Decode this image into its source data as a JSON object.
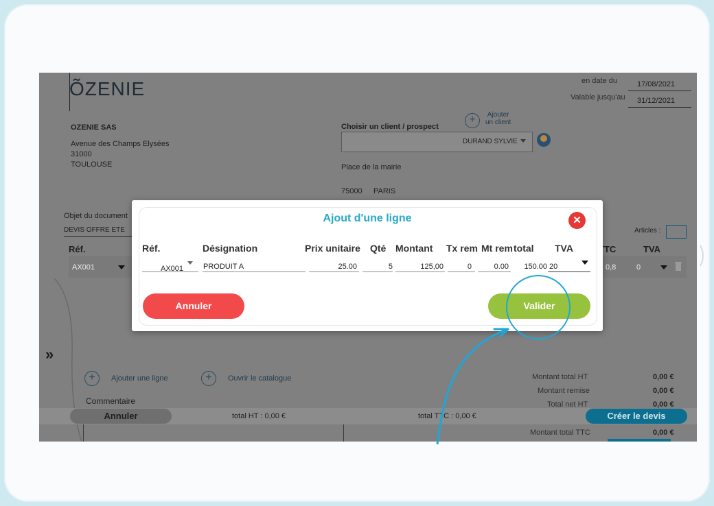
{
  "company": {
    "logo": "ÕZENIE",
    "name": "OZENIE SAS",
    "address": "Avenue des Champs Elysées",
    "postcode": "31000",
    "city": "TOULOUSE"
  },
  "dates": {
    "date_label": "en date du",
    "date_value": "17/08/2021",
    "valid_label": "Valable jusqu'au",
    "valid_value": "31/12/2021"
  },
  "client": {
    "choose_label": "Choisir un client / prospect",
    "add_client_label": "Ajouter\nun client",
    "selected": "DURAND SYLVIE",
    "address": "Place de la mairie",
    "postcode": "75000",
    "city": "PARIS"
  },
  "document": {
    "object_label": "Objet du document",
    "object_value": "DEVIS OFFRE ETE",
    "articles_label": "Articles :"
  },
  "background_table": {
    "ref_header": "Réf.",
    "ttc_header": "TTC",
    "tva_header": "TVA",
    "row_ref": "AX001",
    "row_ttc": "0,8",
    "row_tva": "0"
  },
  "actions": {
    "add_line": "Ajouter une ligne",
    "open_catalogue": "Ouvrir le catalogue",
    "comment_label": "Commentaire"
  },
  "totals": {
    "ht_label": "Montant total HT",
    "ht_value": "0,00 €",
    "remise_label": "Montant remise",
    "remise_value": "0,00 €",
    "net_label": "Total net HT",
    "net_value": "0,00 €",
    "ttc_label": "Montant total TTC",
    "ttc_value": "0,00 €"
  },
  "bottom_bar": {
    "cancel": "Annuler",
    "total_ht": "total HT : 0,00 €",
    "total_ttc": "total TTC : 0,00 €",
    "create": "Créer le devis"
  },
  "modal": {
    "title": "Ajout d'une ligne",
    "headers": {
      "ref": "Réf.",
      "designation": "Désignation",
      "unit_price": "Prix unitaire",
      "qty": "Qté",
      "amount": "Montant",
      "tx_rem": "Tx rem",
      "mt_rem": "Mt rem",
      "total": "total",
      "tva": "TVA"
    },
    "row": {
      "ref": "AX001",
      "designation": "PRODUIT A",
      "unit_price": "25.00",
      "qty": "5",
      "amount": "125,00",
      "tx_rem": "0",
      "mt_rem": "0.00",
      "total": "150.00",
      "tva": "20"
    },
    "cancel_label": "Annuler",
    "validate_label": "Valider"
  },
  "colors": {
    "accent_blue": "#29a8c9",
    "validate_green": "#97c23d",
    "cancel_red": "#f24a4a",
    "close_red": "#e53935",
    "annotation_blue": "#1fa6d8"
  },
  "icons": [
    "logo-tilde",
    "plus-circle-icon",
    "avatar-icon",
    "chevron-double-right-icon",
    "trash-icon",
    "close-icon",
    "caret-down-icon"
  ]
}
